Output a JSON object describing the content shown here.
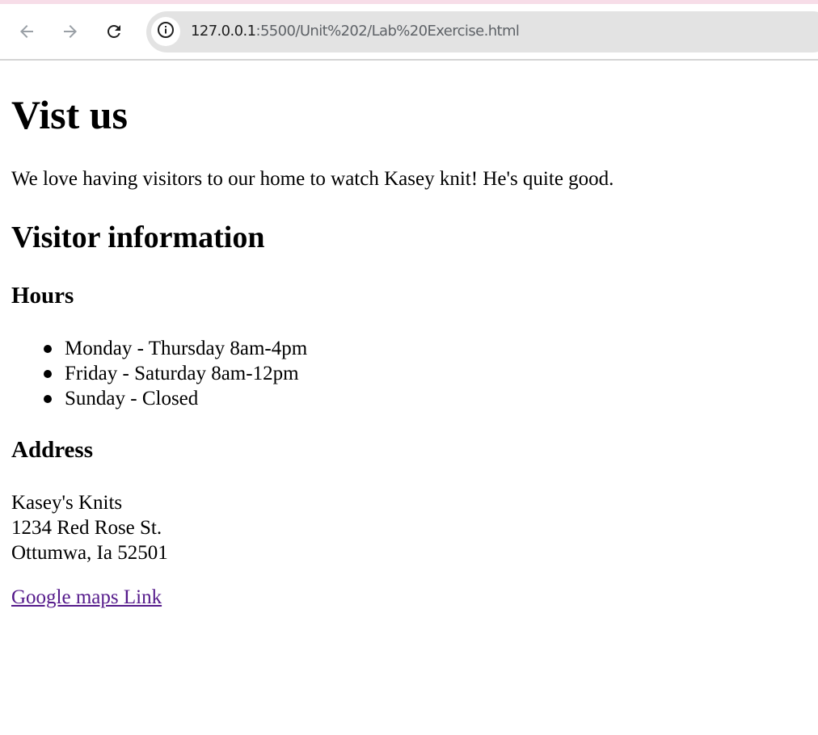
{
  "browser": {
    "url_host": "127.0.0.1",
    "url_rest": ":5500/Unit%202/Lab%20Exercise.html",
    "icons": {
      "back": "arrow-left-icon",
      "forward": "arrow-right-icon",
      "reload": "reload-icon",
      "site_info": "info-icon"
    },
    "colors": {
      "toolbar_bg": "#ffffff",
      "omnibox_bg": "#e3e3e3",
      "top_strip": "#f7dde8"
    }
  },
  "page": {
    "title": "Vist us",
    "intro": "We love having visitors to our home to watch Kasey knit! He's quite good.",
    "visitor_info": {
      "heading": "Visitor information",
      "hours": {
        "heading": "Hours",
        "items": [
          "Monday - Thursday 8am-4pm",
          "Friday - Saturday 8am-12pm",
          "Sunday - Closed"
        ]
      },
      "address": {
        "heading": "Address",
        "lines": [
          "Kasey's Knits",
          "1234 Red Rose St.",
          "Ottumwa, Ia 52501"
        ]
      },
      "link": {
        "label": "Google maps Link",
        "color": "#551a8b"
      }
    }
  }
}
